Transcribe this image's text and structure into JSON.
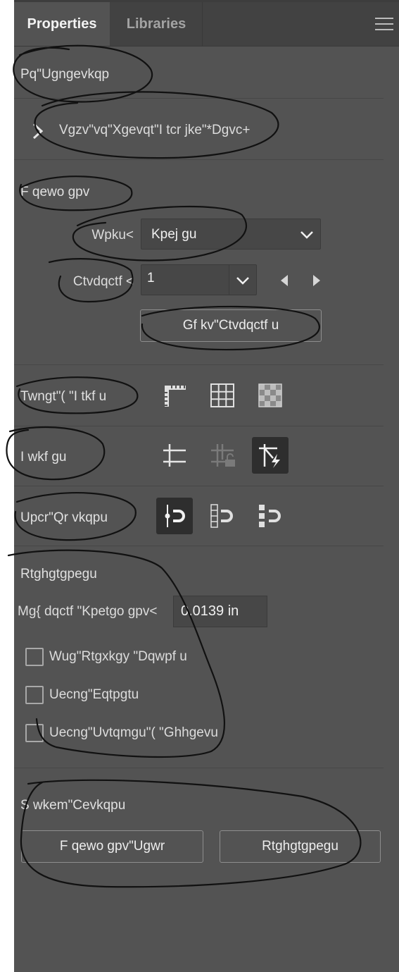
{
  "tabs": [
    {
      "label": "Properties",
      "active": true
    },
    {
      "label": "Libraries",
      "active": false
    }
  ],
  "panel_menu_icon": "hamburger-menu-icon",
  "no_selection": {
    "title": "Pq\"Ugngevkqp",
    "expander_label": "Vgzv\"vq\"Xgevqt\"I tcr jke\"*Dgvc+"
  },
  "document": {
    "title": "F qewo gpv",
    "units_label": "Wpku<",
    "units_value": "Kpej gu",
    "artboard_label": "Ctvdqctf <",
    "artboard_value": "1",
    "edit_artboards_button": "Gf kv\"Ctvdqctf u"
  },
  "ruler_grids": {
    "title": "Twngt\"( \"I tkf u",
    "icons": [
      "ruler-icon",
      "grid-icon",
      "transparency-grid-icon"
    ]
  },
  "guides": {
    "title": "I wkf gu",
    "icons": [
      "guides-icon",
      "lock-guides-icon",
      "smart-guides-icon"
    ]
  },
  "snap_options": {
    "title": "Upcr\"Qr vkqpu",
    "icons": [
      "snap-to-point-icon",
      "snap-to-grid-icon",
      "snap-to-pixel-icon"
    ]
  },
  "preferences": {
    "title": "Rtghgtgpegu",
    "keyboard_increment_label": "Mg{ dqctf \"Kpetgo gpv<",
    "keyboard_increment_value": "0.0139 in",
    "checkboxes": [
      {
        "label": "Wug\"Rtgxkgy \"Dqwpf u",
        "checked": false
      },
      {
        "label": "Uecng\"Eqtpgtu",
        "checked": false
      },
      {
        "label": "Uecng\"Uvtqmgu\"( \"Ghhgevu",
        "checked": false
      }
    ]
  },
  "quick_actions": {
    "title": "S wkem\"Cevkqpu",
    "buttons": [
      "F qewo gpv\"Ugwr",
      "Rtghgtgpegu"
    ]
  },
  "colors": {
    "panel_bg": "#535353",
    "tabbar_bg": "#424242",
    "input_bg": "#474747",
    "selected_icon_bg": "#2e2e2e"
  }
}
